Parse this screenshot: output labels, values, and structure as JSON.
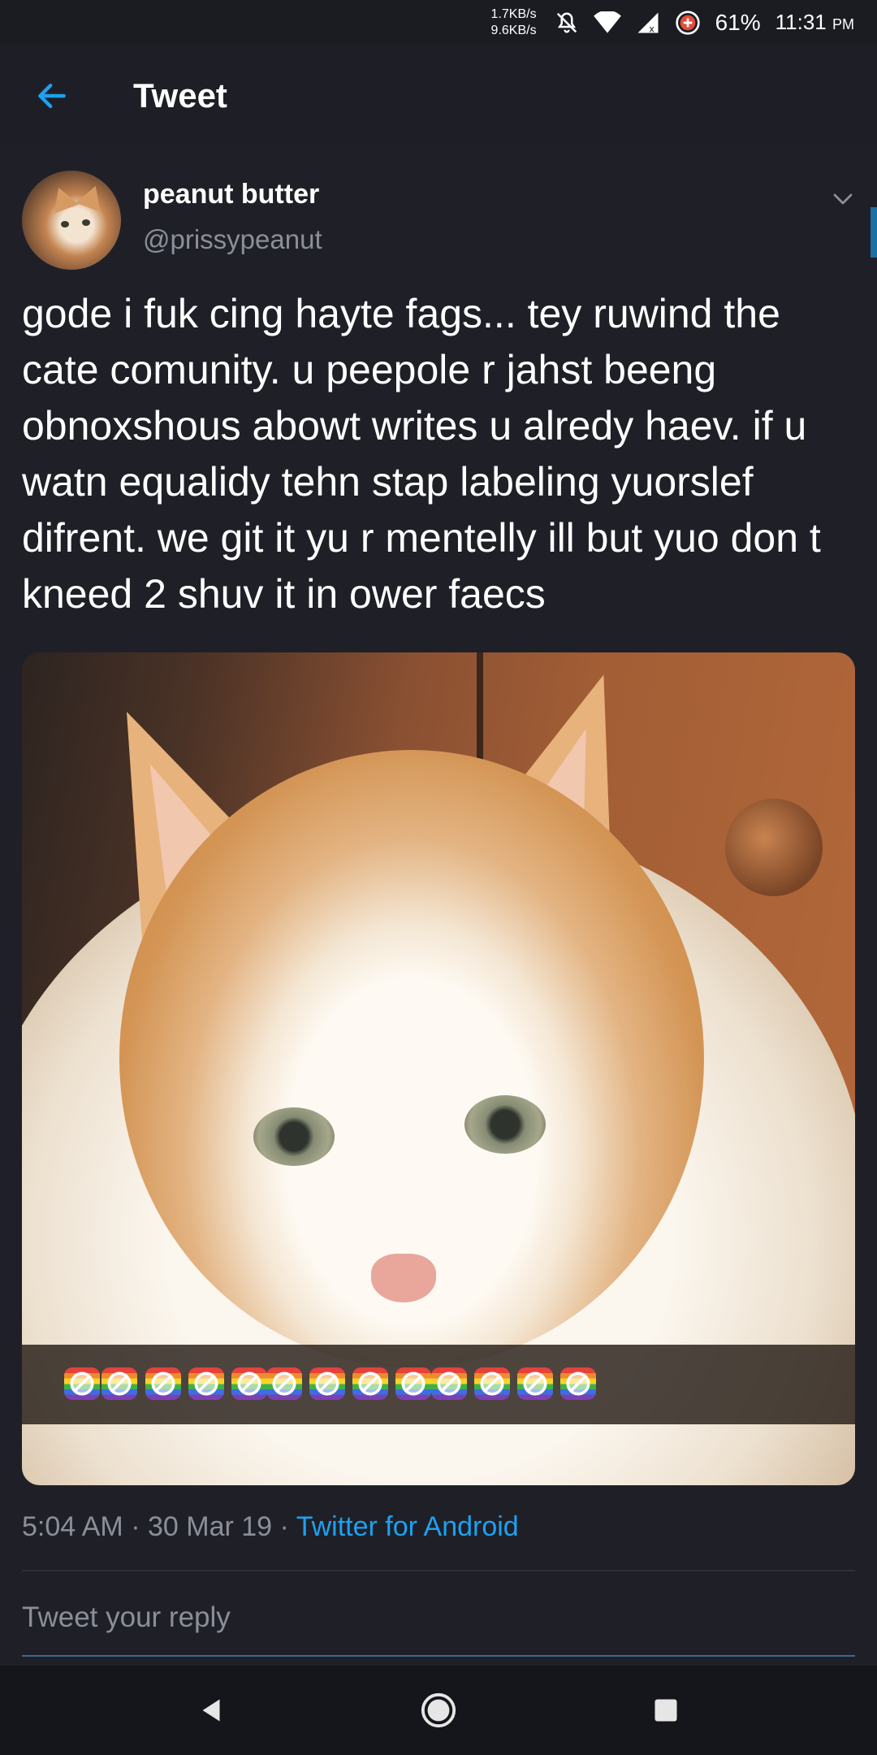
{
  "status_bar": {
    "net_up": "1.7KB/s",
    "net_down": "9.6KB/s",
    "battery": "61%",
    "time": "11:31",
    "ampm": "PM",
    "icons": [
      "mute-icon",
      "wifi-icon",
      "signal-icon",
      "data-saver-icon"
    ]
  },
  "header": {
    "title": "Tweet",
    "back_icon": "arrow-left-icon"
  },
  "tweet": {
    "display_name": "peanut butter",
    "handle": "@prissypeanut",
    "text": "gode i fuk cing hayte fags... tey ruwind the cate comunity. u peepole r jahst beeng obnoxshous abowt writes u alredy haev. if u watn equalidy tehn stap labeling yuorslef difrent. we git it yu r mentelly ill but yuo don t kneed 2 shuv it in ower faecs",
    "menu_icon": "chevron-down-icon",
    "media": {
      "subject": "cat photo",
      "emoji_count": 13,
      "emoji_icon": "no-rainbow-flag-icon"
    },
    "time": "5:04 AM",
    "date": "30 Mar 19",
    "source": "Twitter for Android",
    "separator": "·"
  },
  "reply": {
    "placeholder": "Tweet your reply"
  },
  "nav": {
    "back_icon": "triangle-back-icon",
    "home_icon": "circle-home-icon",
    "recents_icon": "square-recents-icon"
  },
  "colors": {
    "background": "#1f2027",
    "accent": "#1da1f2",
    "secondary_text": "#8a8f99"
  }
}
